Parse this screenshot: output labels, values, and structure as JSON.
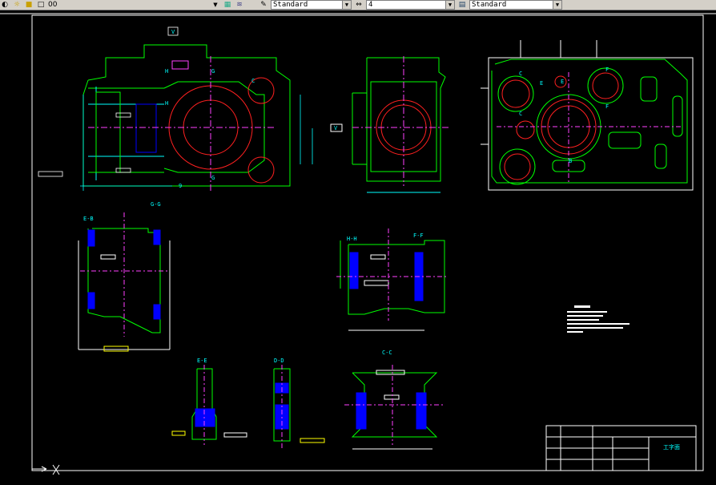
{
  "toolbar": {
    "layer_value": "00",
    "text_style": "Standard",
    "dim_value": "4",
    "dim_style": "Standard"
  },
  "drawing": {
    "section_labels": {
      "eb": "E-B",
      "gg": "G-G",
      "hh": "H-H",
      "ff": "F-F",
      "ee": "E-E",
      "dd": "D-D",
      "cc": "C-C"
    },
    "view_markers": {
      "h": "H",
      "g": "G",
      "c": "C",
      "e": "E",
      "f": "F",
      "b": "B",
      "v": "V",
      "nine": "9"
    },
    "title_block": {
      "title": "工字面"
    }
  },
  "colors": {
    "background": "#000000",
    "outline": "#00ff00",
    "circle": "#ff2020",
    "centerline": "#ff40ff",
    "dimension": "#00ffff",
    "label": "#ffff00",
    "hatch": "#0000ff",
    "frame": "#ffffff"
  }
}
